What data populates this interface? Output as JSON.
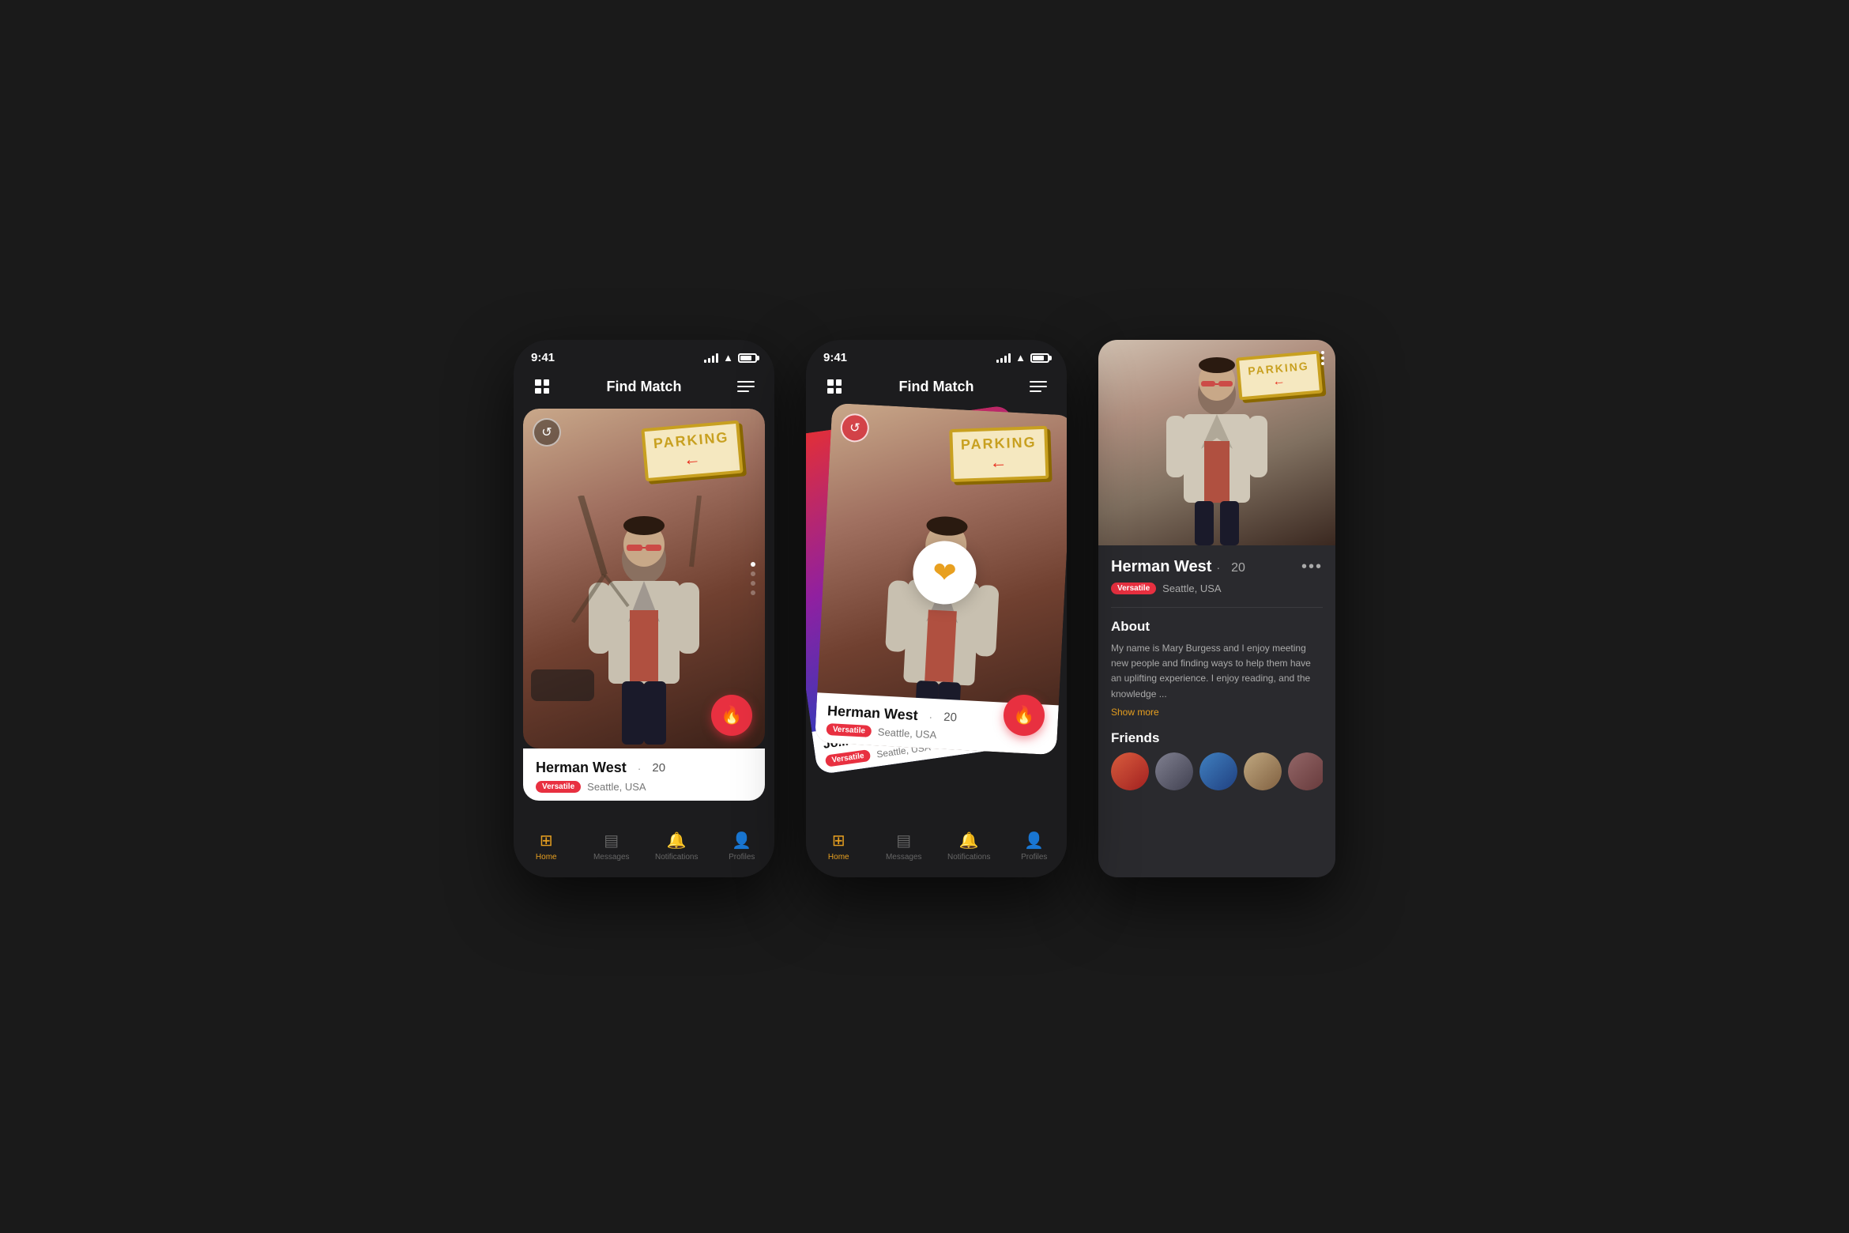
{
  "app": {
    "status_time": "9:41",
    "title": "Find Match"
  },
  "phone1": {
    "status_time": "9:41",
    "title": "Find Match",
    "card": {
      "name": "Herman West",
      "age": "20",
      "badge": "Versatile",
      "location": "Seattle, USA"
    },
    "nav": {
      "home": "Home",
      "messages": "Messages",
      "notifications": "Notifications",
      "profiles": "Profiles"
    }
  },
  "phone2": {
    "status_time": "9:41",
    "title": "Find Match",
    "main_card": {
      "name": "Herman West",
      "age": "20",
      "badge": "Versatile",
      "location": "Seattle, USA"
    },
    "back_card": {
      "name": "Jo...",
      "badge": "Versatile",
      "location": "Seattle, USA"
    },
    "nav": {
      "home": "Home",
      "messages": "Messages",
      "notifications": "Notifications",
      "profiles": "Profiles"
    }
  },
  "profile": {
    "name": "Herman West",
    "dot_separator": "·",
    "age": "20",
    "badge": "Versatile",
    "location": "Seattle, USA",
    "about_title": "About",
    "about_text": "My name is Mary Burgess and I enjoy meeting new people and finding ways to help them have an uplifting experience. I enjoy reading, and the knowledge ...",
    "show_more": "Show more",
    "friends_title": "Friends",
    "more_dots": "•••"
  },
  "icons": {
    "home": "⊞",
    "messages": "▤",
    "notifications": "🔔",
    "profiles": "👤",
    "undo": "↺",
    "flame": "🔥",
    "heart": "❤",
    "grid": "⊞",
    "menu": "≡",
    "dots": "•••"
  },
  "colors": {
    "accent_orange": "#e8a020",
    "accent_red": "#e83040",
    "bg_dark": "#1c1c1e",
    "panel_bg": "#2a2a2e",
    "text_white": "#ffffff",
    "text_gray": "#aaaaaa",
    "badge_red": "#e83040"
  }
}
